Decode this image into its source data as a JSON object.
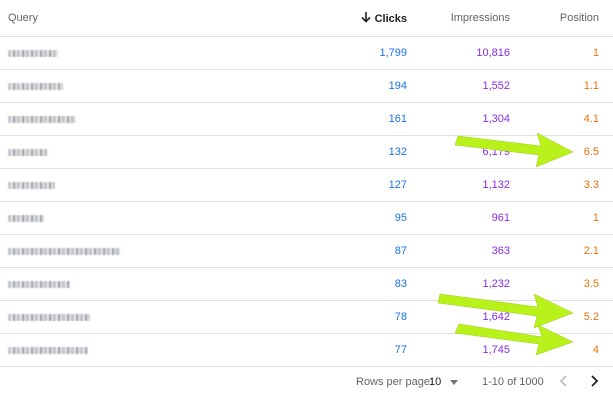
{
  "table": {
    "headers": {
      "query": "Query",
      "clicks": "Clicks",
      "impressions": "Impressions",
      "position": "Position"
    },
    "sort_icon": "arrow-down-icon",
    "rows": [
      {
        "clicks": "1,799",
        "impressions": "10,816",
        "position": "1"
      },
      {
        "clicks": "194",
        "impressions": "1,552",
        "position": "1.1"
      },
      {
        "clicks": "161",
        "impressions": "1,304",
        "position": "4.1"
      },
      {
        "clicks": "132",
        "impressions": "6,179",
        "position": "6.5"
      },
      {
        "clicks": "127",
        "impressions": "1,132",
        "position": "3.3"
      },
      {
        "clicks": "95",
        "impressions": "961",
        "position": "1"
      },
      {
        "clicks": "87",
        "impressions": "363",
        "position": "2.1"
      },
      {
        "clicks": "83",
        "impressions": "1,232",
        "position": "3.5"
      },
      {
        "clicks": "78",
        "impressions": "1,642",
        "position": "5.2"
      },
      {
        "clicks": "77",
        "impressions": "1,745",
        "position": "4"
      }
    ]
  },
  "footer": {
    "rows_per_page_label": "Rows per page:",
    "rows_per_page_value": "10",
    "range_text": "1-10 of 1000"
  },
  "colors": {
    "clicks": "#1a73e8",
    "impressions": "#8a2be2",
    "position": "#e8710a",
    "annotation_arrow": "#b9f21b"
  }
}
